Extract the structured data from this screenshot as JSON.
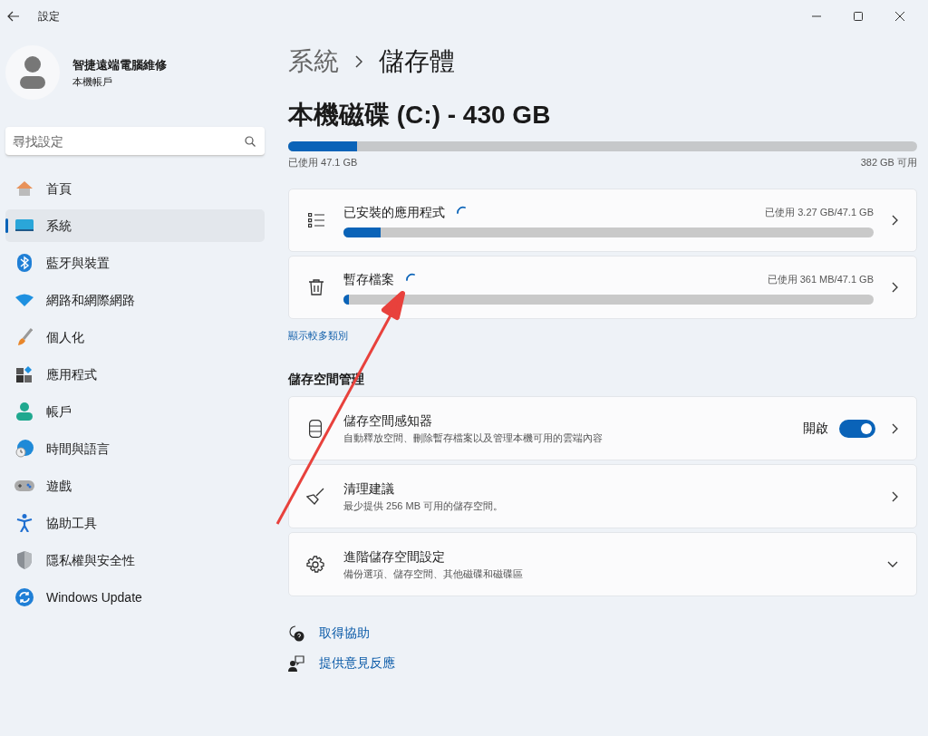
{
  "window": {
    "title": "設定"
  },
  "account": {
    "name": "智捷遠端電腦維修",
    "type": "本機帳戶"
  },
  "search": {
    "placeholder": "尋找設定"
  },
  "sidebar": {
    "items": [
      {
        "label": "首頁",
        "selected": false
      },
      {
        "label": "系統",
        "selected": true
      },
      {
        "label": "藍牙與裝置",
        "selected": false
      },
      {
        "label": "網路和網際網路",
        "selected": false
      },
      {
        "label": "個人化",
        "selected": false
      },
      {
        "label": "應用程式",
        "selected": false
      },
      {
        "label": "帳戶",
        "selected": false
      },
      {
        "label": "時間與語言",
        "selected": false
      },
      {
        "label": "遊戲",
        "selected": false
      },
      {
        "label": "協助工具",
        "selected": false
      },
      {
        "label": "隱私權與安全性",
        "selected": false
      },
      {
        "label": "Windows Update",
        "selected": false
      }
    ]
  },
  "breadcrumb": [
    "系統",
    "儲存體"
  ],
  "disk": {
    "title": "本機磁碟 (C:) - 430 GB",
    "level": 0.11,
    "used": "已使用 47.1 GB",
    "free": "382 GB 可用"
  },
  "categories": [
    {
      "name": "已安裝的應用程式",
      "usage": "已使用 3.27 GB/47.1 GB",
      "level": 0.07,
      "loading": true
    },
    {
      "name": "暫存檔案",
      "usage": "已使用 361 MB/47.1 GB",
      "level": 0.01,
      "loading": true
    }
  ],
  "show_more_link": "顯示較多類別",
  "management": {
    "heading": "儲存空間管理",
    "items": [
      {
        "kind": "toggle",
        "title": "儲存空間感知器",
        "description": "自動釋放空間、刪除暫存檔案以及管理本機可用的雲端內容",
        "toggle_label": "開啟",
        "on": true
      },
      {
        "kind": "link",
        "title": "清理建議",
        "description": "最少提供 256 MB 可用的儲存空間。"
      },
      {
        "kind": "expand",
        "title": "進階儲存空間設定",
        "description": "備份選項、儲存空間、其他磁碟和磁碟區",
        "expanded": false
      }
    ]
  },
  "footer_links": [
    "取得協助",
    "提供意見反應"
  ],
  "annotation": {
    "kind": "arrow"
  }
}
